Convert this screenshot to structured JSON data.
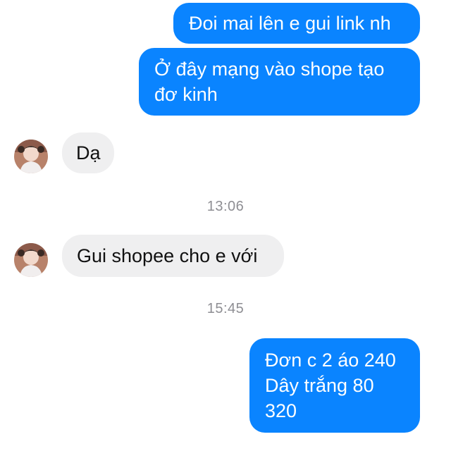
{
  "messages": {
    "m1": "Đoi mai lên e gui link nh",
    "m2": "Ở đây mạng vào shope tạo\nđơ kinh",
    "m3": "Dạ",
    "m4": "Gui shopee cho e với",
    "m5": "Đơn c 2 áo 240\nDây trắng 80\n320"
  },
  "timestamps": {
    "t1": "13:06",
    "t2": "15:45"
  },
  "colors": {
    "outgoing_bubble": "#0a84ff",
    "incoming_bubble": "#efeff0",
    "timestamp_text": "#8e8e93"
  }
}
